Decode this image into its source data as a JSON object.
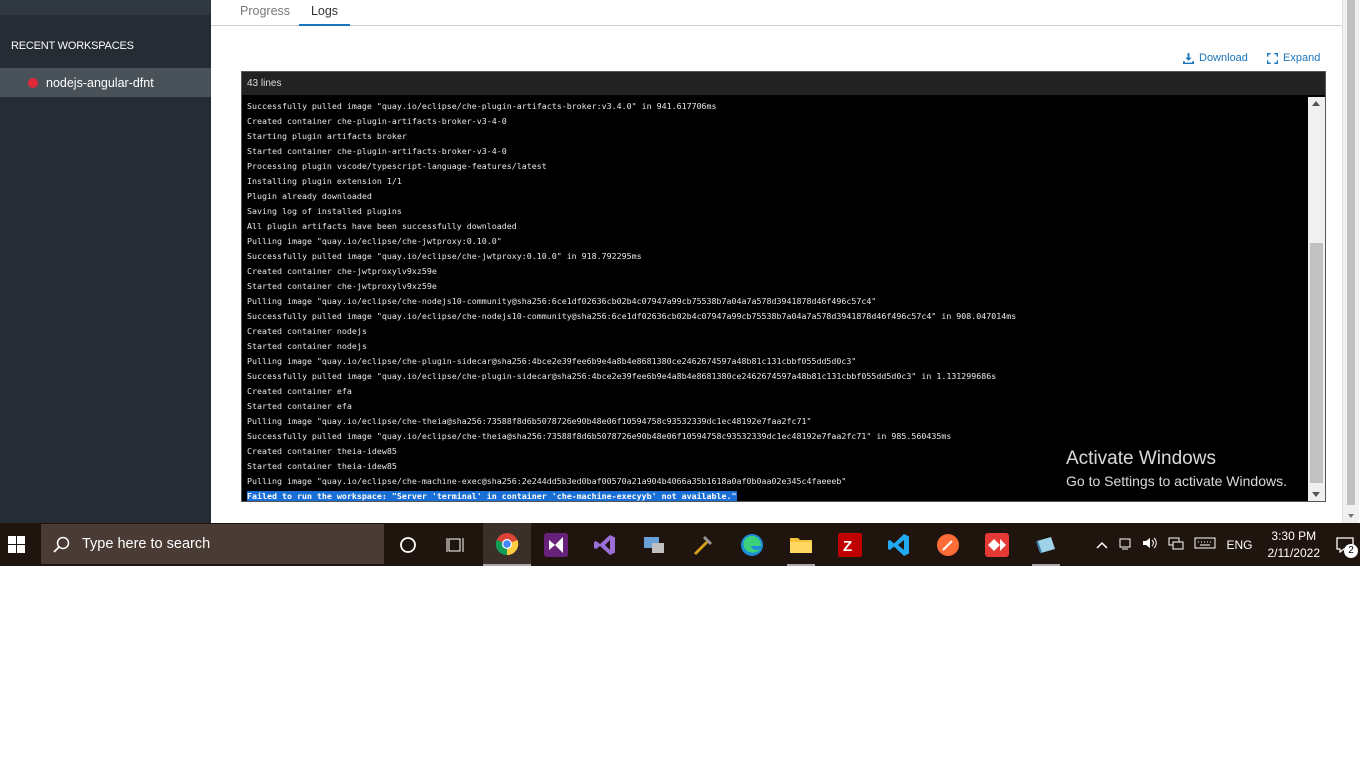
{
  "sidebar": {
    "section_title": "RECENT WORKSPACES",
    "workspaces": [
      {
        "name": "nodejs-angular-dfnt",
        "status_color": "#e0293a"
      }
    ]
  },
  "tabs": [
    {
      "label": "Progress"
    },
    {
      "label": "Logs",
      "active": true
    }
  ],
  "actions": {
    "download": "Download",
    "expand": "Expand"
  },
  "log": {
    "line_count": "43 lines",
    "lines": [
      "Successfully pulled image \"quay.io/eclipse/che-plugin-artifacts-broker:v3.4.0\" in 941.617706ms",
      "Created container che-plugin-artifacts-broker-v3-4-0",
      "Starting plugin artifacts broker",
      "Started container che-plugin-artifacts-broker-v3-4-0",
      "Processing plugin vscode/typescript-language-features/latest",
      "Installing plugin extension 1/1",
      "Plugin already downloaded",
      "Saving log of installed plugins",
      "All plugin artifacts have been successfully downloaded",
      "Pulling image \"quay.io/eclipse/che-jwtproxy:0.10.0\"",
      "Successfully pulled image \"quay.io/eclipse/che-jwtproxy:0.10.0\" in 918.792295ms",
      "Created container che-jwtproxylv9xz59e",
      "Started container che-jwtproxylv9xz59e",
      "Pulling image \"quay.io/eclipse/che-nodejs10-community@sha256:6ce1df02636cb02b4c07947a99cb75538b7a04a7a578d3941878d46f496c57c4\"",
      "Successfully pulled image \"quay.io/eclipse/che-nodejs10-community@sha256:6ce1df02636cb02b4c07947a99cb75538b7a04a7a578d3941878d46f496c57c4\" in 908.047014ms",
      "Created container nodejs",
      "Started container nodejs",
      "Pulling image \"quay.io/eclipse/che-plugin-sidecar@sha256:4bce2e39fee6b9e4a8b4e8681380ce2462674597a48b81c131cbbf055dd5d0c3\"",
      "Successfully pulled image \"quay.io/eclipse/che-plugin-sidecar@sha256:4bce2e39fee6b9e4a8b4e8681380ce2462674597a48b81c131cbbf055dd5d0c3\" in 1.131299686s",
      "Created container efa",
      "Started container efa",
      "Pulling image \"quay.io/eclipse/che-theia@sha256:73588f8d6b5078726e90b48e06f10594758c93532339dc1ec48192e7faa2fc71\"",
      "Successfully pulled image \"quay.io/eclipse/che-theia@sha256:73588f8d6b5078726e90b48e06f10594758c93532339dc1ec48192e7faa2fc71\" in 985.560435ms",
      "Created container theia-idew85",
      "Started container theia-idew85",
      "Pulling image \"quay.io/eclipse/che-machine-exec@sha256:2e244dd5b3ed0baf00570a21a904b4066a35b1618a0af0b0aa02e345c4faeeeb\""
    ],
    "error_line": "Failed to run the workspace: \"Server 'terminal' in container 'che-machine-execyyb' not available.\""
  },
  "watermark": {
    "title": "Activate Windows",
    "subtitle": "Go to Settings to activate Windows."
  },
  "taskbar": {
    "search_placeholder": "Type here to search",
    "language": "ENG",
    "time": "3:30 PM",
    "date": "2/11/2022",
    "notification_count": "2"
  }
}
